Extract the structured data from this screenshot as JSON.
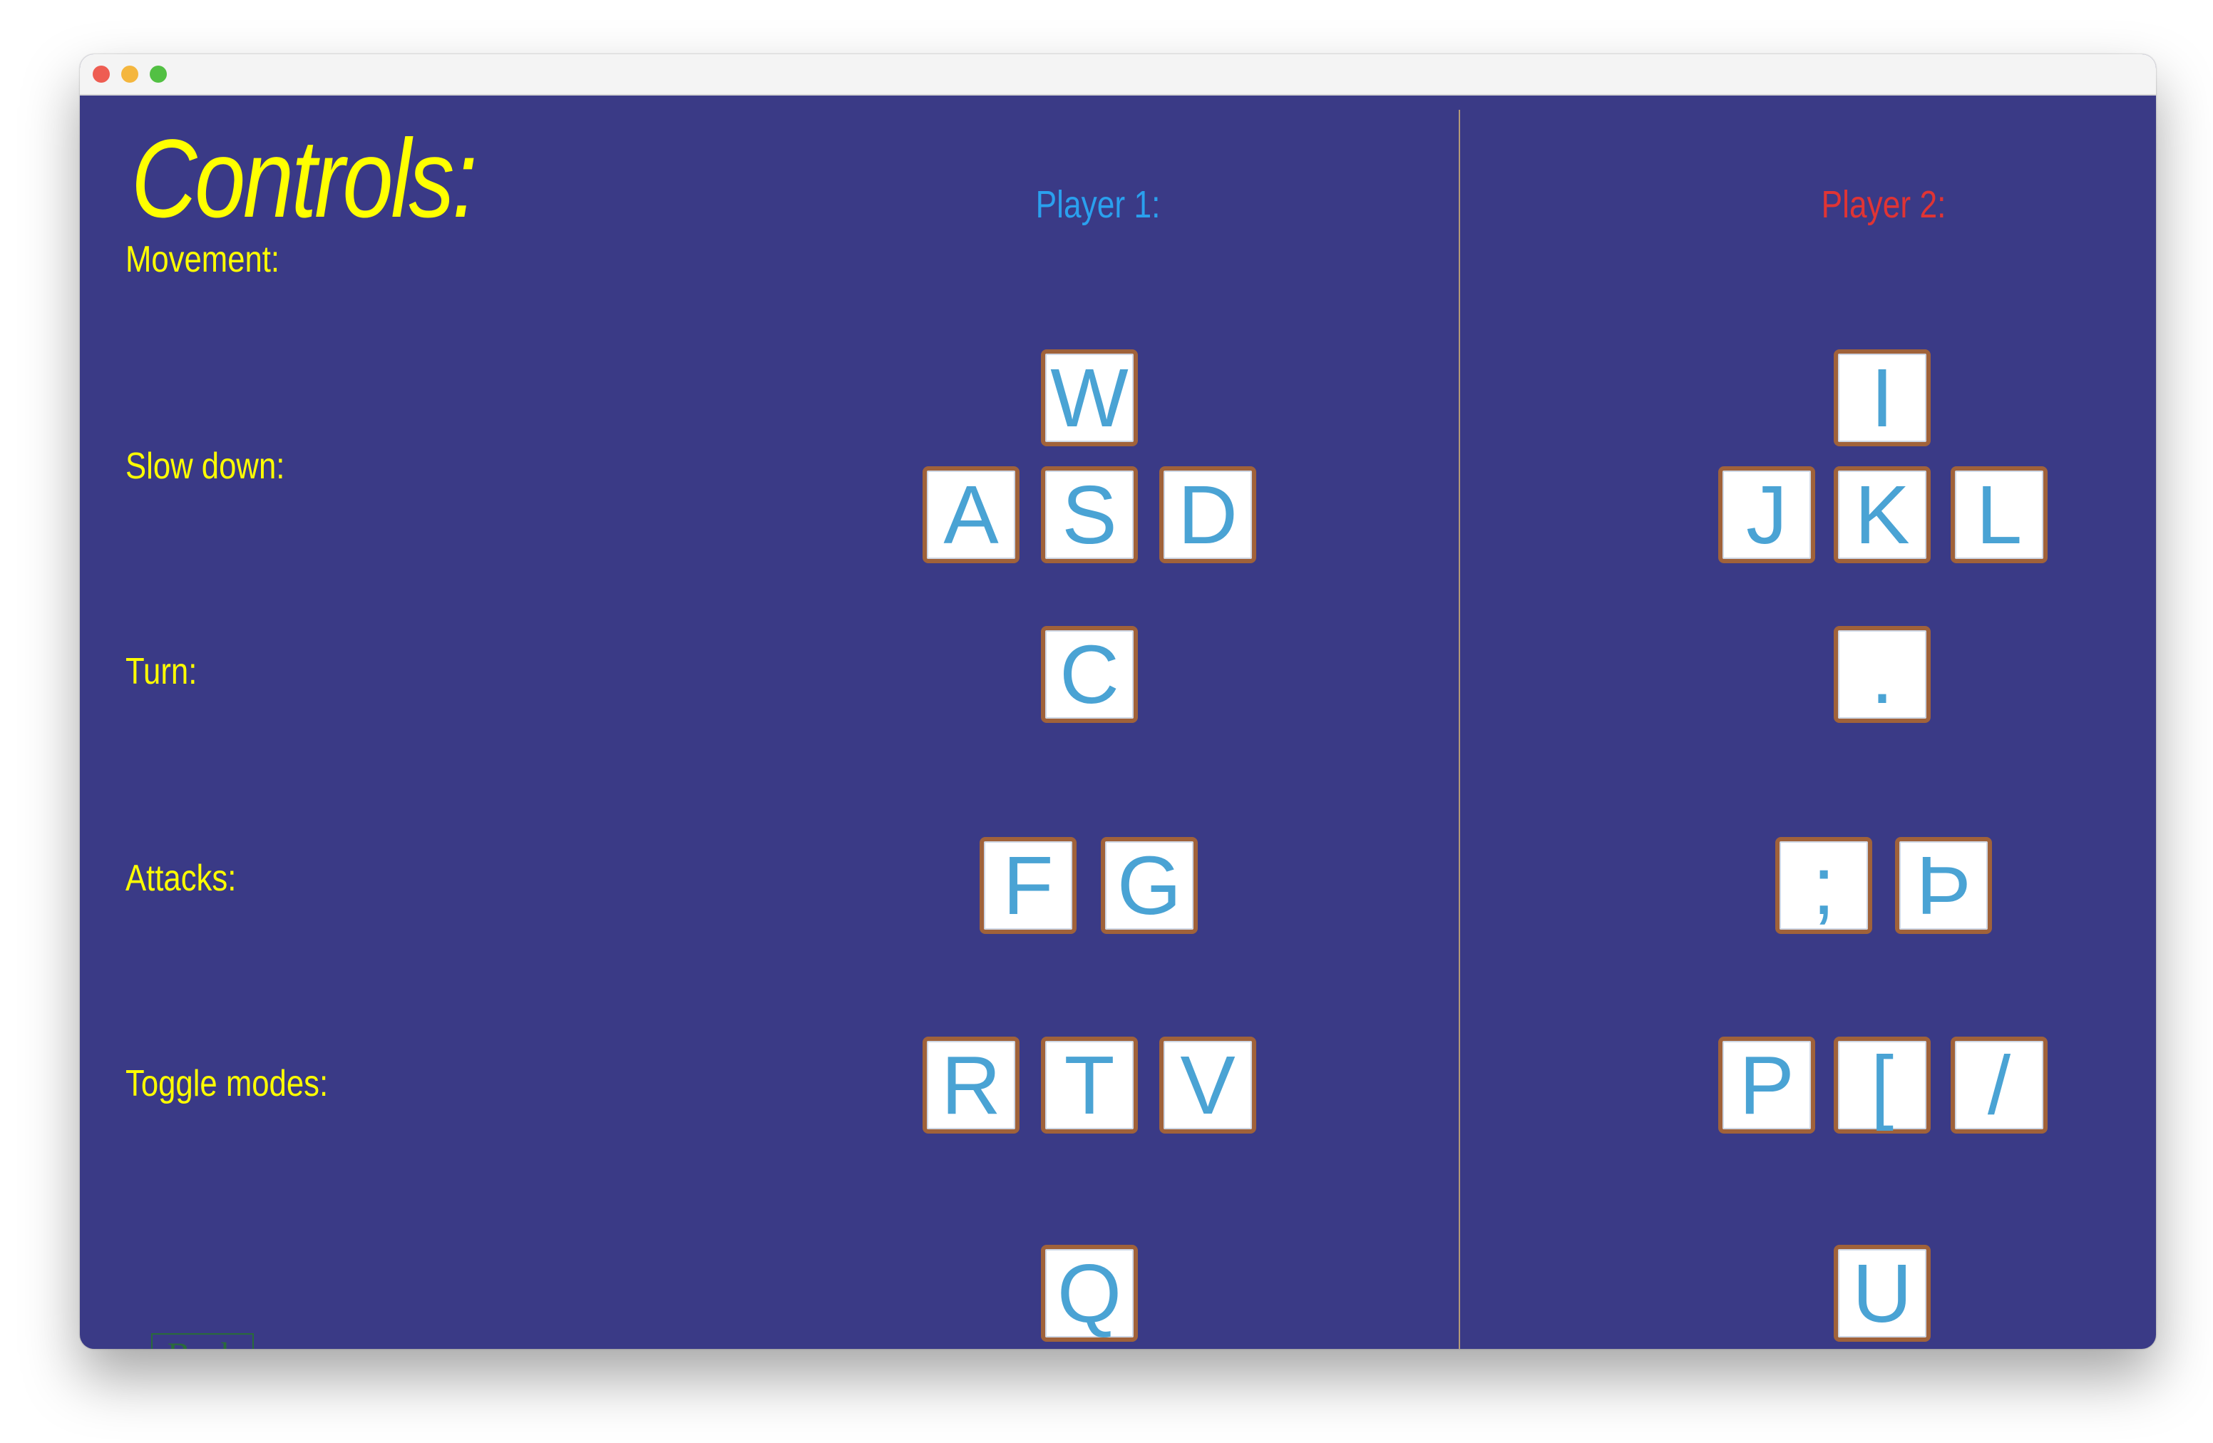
{
  "page": {
    "title": "Controls:",
    "back_label": "Back"
  },
  "players": [
    {
      "name": "Player 1:",
      "color": "#2aa0ee"
    },
    {
      "name": "Player 2:",
      "color": "#e03434"
    }
  ],
  "rows": [
    {
      "label": "Movement:"
    },
    {
      "label": "Slow down:"
    },
    {
      "label": "Turn:"
    },
    {
      "label": "Attacks:"
    },
    {
      "label": "Toggle modes:"
    }
  ],
  "keys": {
    "p1": {
      "up": "W",
      "left": "A",
      "down": "S",
      "right": "D",
      "slow": "C",
      "turn_left": "F",
      "turn_right": "G",
      "attack_1": "R",
      "attack_2": "T",
      "attack_3": "V",
      "toggle": "Q"
    },
    "p2": {
      "up": "I",
      "left": "J",
      "down": "K",
      "right": "L",
      "slow": ".",
      "turn_left": ";",
      "turn_right": "Þ",
      "attack_1": "P",
      "attack_2": "[",
      "attack_3": "/",
      "toggle": "U"
    }
  },
  "colors": {
    "background": "#3a3a86",
    "label_text": "#ffff00",
    "key_text": "#4aa3d4",
    "key_border": "#a0623a",
    "divider": "#b49a78",
    "back_button": "#2a6b3a"
  }
}
